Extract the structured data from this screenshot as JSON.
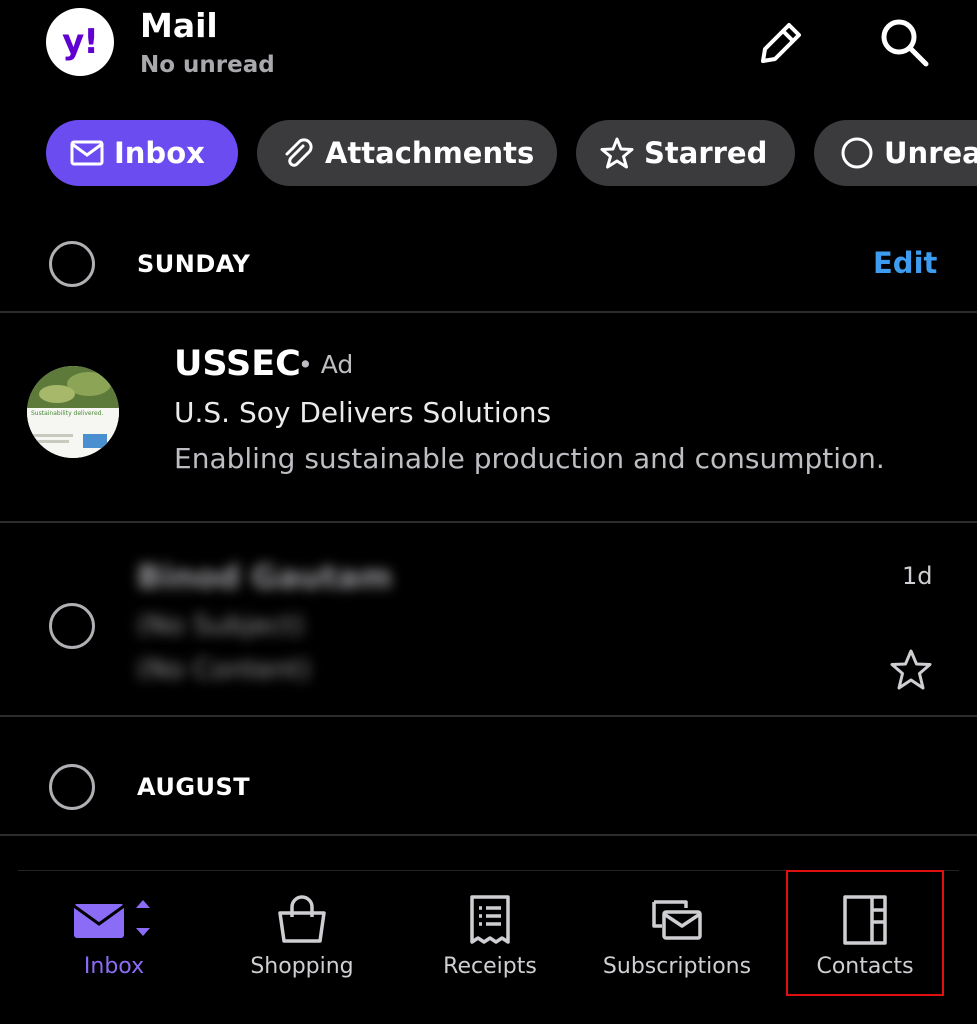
{
  "header": {
    "logo_text": "y!",
    "title": "Mail",
    "subtitle": "No unread"
  },
  "filters": [
    {
      "label": "Inbox",
      "icon": "envelope-icon",
      "active": true
    },
    {
      "label": "Attachments",
      "icon": "paperclip-icon",
      "active": false
    },
    {
      "label": "Starred",
      "icon": "star-icon",
      "active": false
    },
    {
      "label": "Unread",
      "icon": "circle-icon",
      "active": false
    }
  ],
  "sections": {
    "sunday": {
      "label": "SUNDAY",
      "edit_label": "Edit"
    },
    "august": {
      "label": "AUGUST"
    }
  },
  "ad": {
    "sender": "USSEC",
    "tag": "• Ad",
    "subject": "U.S. Soy Delivers Solutions",
    "snippet": "Enabling sustainable production and consumption.",
    "avatar_text": "Sustainability delivered."
  },
  "message": {
    "sender": "Binod Gautam",
    "subject": "(No Subject)",
    "snippet": "(No Content)",
    "time": "1d"
  },
  "bottom_nav": [
    {
      "label": "Inbox",
      "icon": "mail-icon",
      "active": true
    },
    {
      "label": "Shopping",
      "icon": "shopping-bag-icon",
      "active": false
    },
    {
      "label": "Receipts",
      "icon": "receipt-icon",
      "active": false
    },
    {
      "label": "Subscriptions",
      "icon": "subscriptions-icon",
      "active": false
    },
    {
      "label": "Contacts",
      "icon": "contacts-book-icon",
      "active": false
    }
  ],
  "colors": {
    "accent": "#6b4cf0",
    "link": "#3d9bf0",
    "highlight_box": "#e01010"
  }
}
